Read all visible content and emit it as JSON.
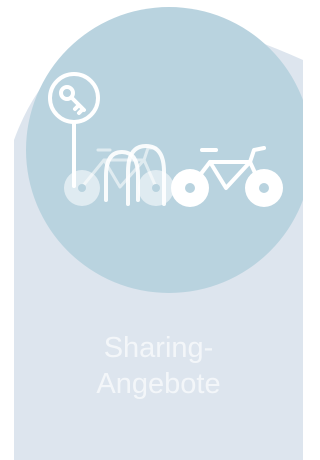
{
  "tile": {
    "label_line1": "Sharing-",
    "label_line2": "Angebote",
    "icon": "bike-sharing-icon"
  },
  "colors": {
    "panel": "#dde5ee",
    "circle": "#b9d3df",
    "icon": "#ffffff",
    "label": "#f3f6f9"
  }
}
